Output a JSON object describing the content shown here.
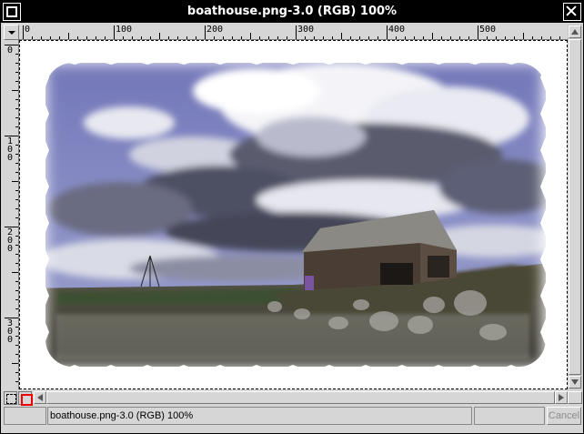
{
  "window": {
    "title": "boathouse.png-3.0 (RGB) 100%"
  },
  "ruler": {
    "horizontal_labels": [
      "0",
      "100",
      "200",
      "300",
      "400",
      "500"
    ],
    "vertical_labels": [
      "0",
      "100",
      "200",
      "300"
    ]
  },
  "image": {
    "subject": "boathouse under cloudy sky with fuzzy-border frame",
    "sky_color": "#8088c8",
    "frame_color": "#ffffff"
  },
  "statusbar": {
    "message": "boathouse.png-3.0 (RGB) 100%",
    "cancel_label": "Cancel"
  },
  "icons": {
    "menu": "window-menu-icon",
    "close": "close-icon",
    "ruler_menu": "triangle-menu-icon",
    "quickmask_off": "quickmask-off-icon",
    "quickmask_on": "quickmask-on-icon",
    "navigate": "navigate-icon"
  }
}
